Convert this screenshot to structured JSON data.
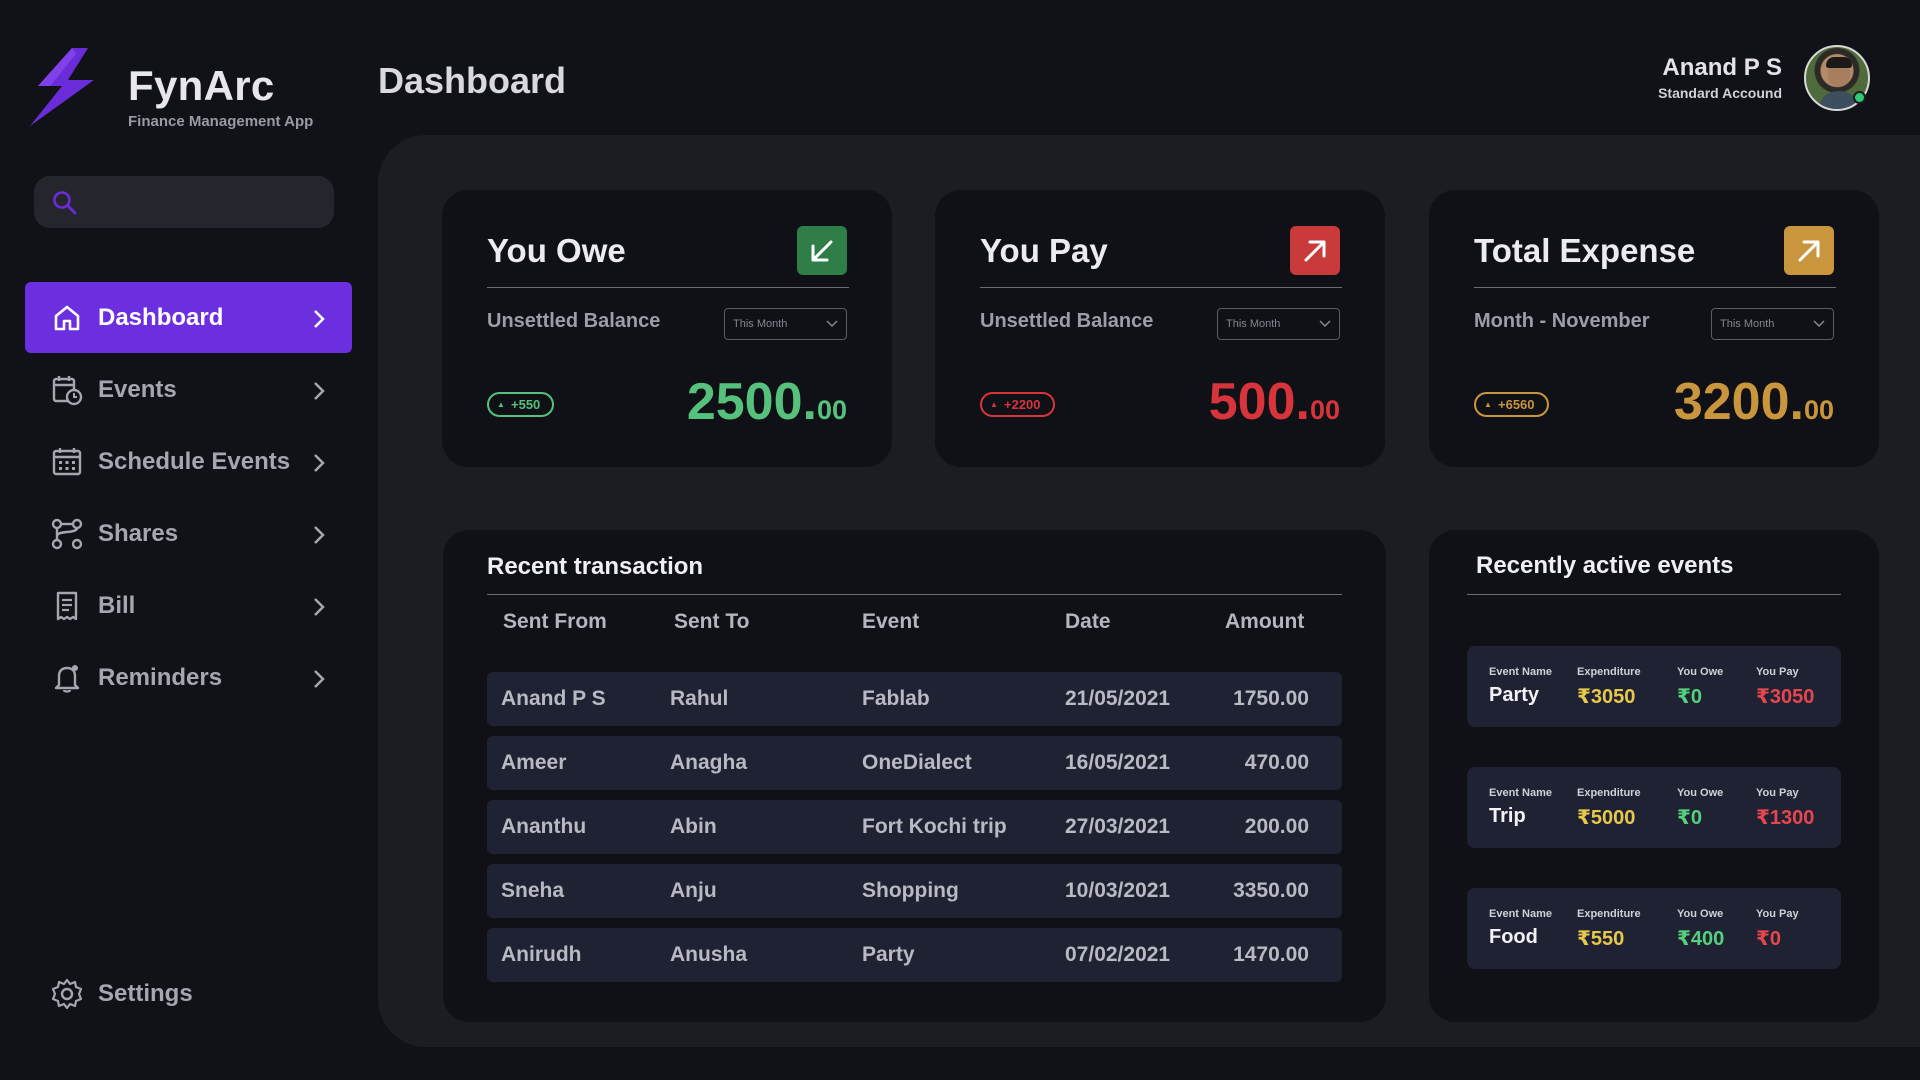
{
  "app": {
    "name": "FynArc",
    "subtitle": "Finance Management App"
  },
  "search": {
    "placeholder": "",
    "value": ""
  },
  "nav": {
    "items": [
      {
        "label": "Dashboard",
        "icon": "home-icon",
        "active": true
      },
      {
        "label": "Events",
        "icon": "calendar-clock-icon"
      },
      {
        "label": "Schedule Events",
        "icon": "calendar-grid-icon"
      },
      {
        "label": "Shares",
        "icon": "share-nodes-icon"
      },
      {
        "label": "Bill",
        "icon": "receipt-icon"
      },
      {
        "label": "Reminders",
        "icon": "bell-icon"
      }
    ],
    "settings_label": "Settings"
  },
  "header": {
    "title": "Dashboard",
    "user_name": "Anand P S",
    "user_role": "Standard Accound"
  },
  "cards": [
    {
      "title": "You Owe",
      "subtitle": "Unsettled Balance",
      "period": "This Month",
      "badge": "+550",
      "amount_int": "2500.",
      "amount_dec": "00",
      "icon": "arrow-down-left-icon",
      "color": "#55c17c",
      "icon_bg": "#2f7d47"
    },
    {
      "title": "You Pay",
      "subtitle": "Unsettled Balance",
      "period": "This Month",
      "badge": "+2200",
      "amount_int": "500.",
      "amount_dec": "00",
      "icon": "arrow-up-right-icon",
      "color": "#d8343c",
      "icon_bg": "#c93a3a"
    },
    {
      "title": "Total Expense",
      "subtitle": "Month - November",
      "period": "This Month",
      "badge": "+6560",
      "amount_int": "3200.",
      "amount_dec": "00",
      "icon": "arrow-up-right-icon",
      "color": "#c9963e",
      "icon_bg": "#c9963e"
    }
  ],
  "transactions": {
    "title": "Recent transaction",
    "columns": [
      "Sent From",
      "Sent To",
      "Event",
      "Date",
      "Amount"
    ],
    "rows": [
      [
        "Anand P S",
        "Rahul",
        "Fablab",
        "21/05/2021",
        "1750.00"
      ],
      [
        "Ameer",
        "Anagha",
        "OneDialect",
        "16/05/2021",
        "470.00"
      ],
      [
        "Ananthu",
        "Abin",
        "Fort Kochi trip",
        "27/03/2021",
        "200.00"
      ],
      [
        "Sneha",
        "Anju",
        "Shopping",
        "10/03/2021",
        "3350.00"
      ],
      [
        "Anirudh",
        "Anusha",
        "Party",
        "07/02/2021",
        "1470.00"
      ]
    ]
  },
  "events": {
    "title": "Recently active events",
    "headers": {
      "name": "Event Name",
      "expenditure": "Expenditure",
      "owe": "You Owe",
      "pay": "You Pay"
    },
    "items": [
      {
        "name": "Party",
        "expenditure": "₹3050",
        "owe": "₹0",
        "pay": "₹3050"
      },
      {
        "name": "Trip",
        "expenditure": "₹5000",
        "owe": "₹0",
        "pay": "₹1300"
      },
      {
        "name": "Food",
        "expenditure": "₹550",
        "owe": "₹400",
        "pay": "₹0"
      }
    ]
  }
}
